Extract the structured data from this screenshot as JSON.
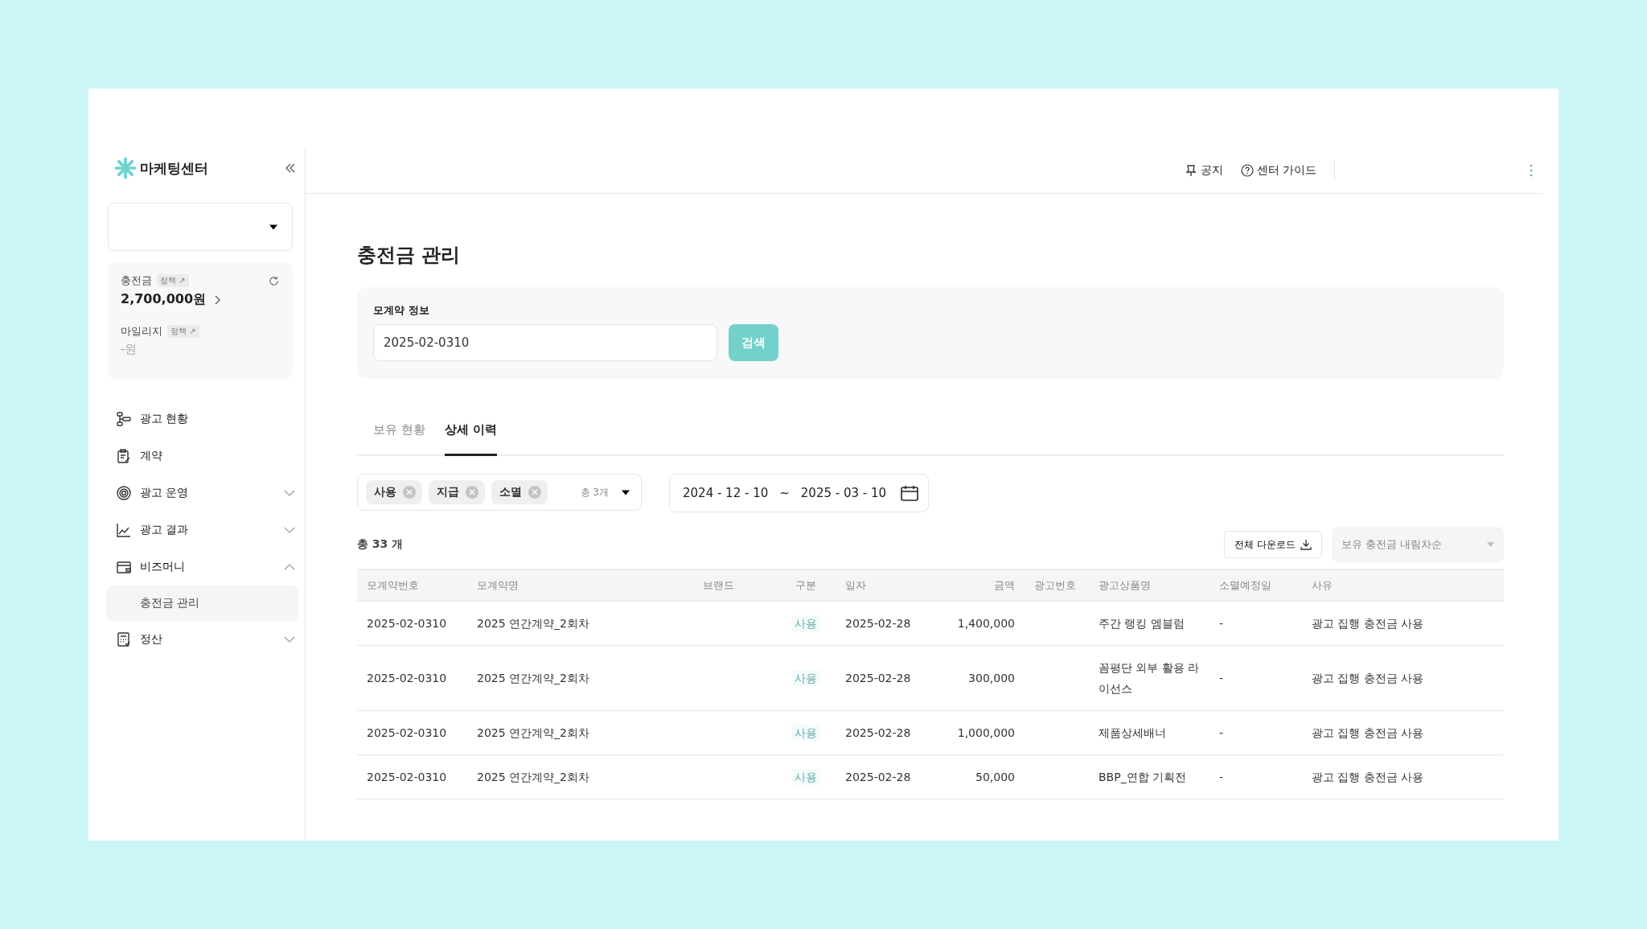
{
  "sidebar": {
    "logo": "마케팅센터",
    "balance": {
      "label": "충전금",
      "policy": "정책 ↗",
      "amount": "2,700,000원"
    },
    "mileage": {
      "label": "마일리지",
      "policy": "정책 ↗",
      "amount": "-원"
    },
    "items": [
      {
        "label": "광고 현황",
        "kind": "status"
      },
      {
        "label": "계약",
        "kind": "contract"
      },
      {
        "label": "광고 운영",
        "kind": "target",
        "expanded": false
      },
      {
        "label": "광고 결과",
        "kind": "chart",
        "expanded": false
      },
      {
        "label": "비즈머니",
        "kind": "wallet",
        "expanded": true,
        "children": [
          {
            "label": "충전금 관리",
            "selected": true
          }
        ]
      },
      {
        "label": "정산",
        "kind": "calc",
        "expanded": false
      }
    ]
  },
  "header": {
    "links": [
      {
        "label": "공지",
        "kind": "pin"
      },
      {
        "label": "센터 가이드",
        "kind": "help"
      }
    ]
  },
  "page_title": "충전금 관리",
  "search": {
    "label": "모계약 정보",
    "value": "2025-02-0310",
    "button": "검색"
  },
  "tabs": [
    {
      "label": "보유 현황",
      "selected": false
    },
    {
      "label": "상세 이력",
      "selected": true
    }
  ],
  "filter": {
    "chips": [
      "사용",
      "지급",
      "소멸"
    ],
    "count": "총 3개",
    "date_from": "2024 - 12 - 10",
    "tilde": "~",
    "date_to": "2025 - 03 - 10"
  },
  "total": "총 33 개",
  "download": "전체 다운로드",
  "sort": "보유 충전금 내림차순",
  "table": {
    "columns": [
      "모계약번호",
      "모계약명",
      "브랜드",
      "구분",
      "일자",
      "금액",
      "광고번호",
      "광고상품명",
      "소멸예정일",
      "사유"
    ],
    "rows": [
      [
        "2025-02-0310",
        "2025 연간계약_2회차",
        "",
        "사용",
        "2025-02-28",
        "1,400,000",
        "",
        "주간 랭킹 엠블럼",
        "-",
        "광고 집행 충전금 사용"
      ],
      [
        "2025-02-0310",
        "2025 연간계약_2회차",
        "",
        "사용",
        "2025-02-28",
        "300,000",
        "",
        "꼼평단 외부 활용 라이선스",
        "-",
        "광고 집행 충전금 사용"
      ],
      [
        "2025-02-0310",
        "2025 연간계약_2회차",
        "",
        "사용",
        "2025-02-28",
        "1,000,000",
        "",
        "제품상세배너",
        "-",
        "광고 집행 충전금 사용"
      ],
      [
        "2025-02-0310",
        "2025 연간계약_2회차",
        "",
        "사용",
        "2025-02-28",
        "50,000",
        "",
        "BBP_연합 기획전",
        "-",
        "광고 집행 충전금 사용"
      ]
    ]
  }
}
